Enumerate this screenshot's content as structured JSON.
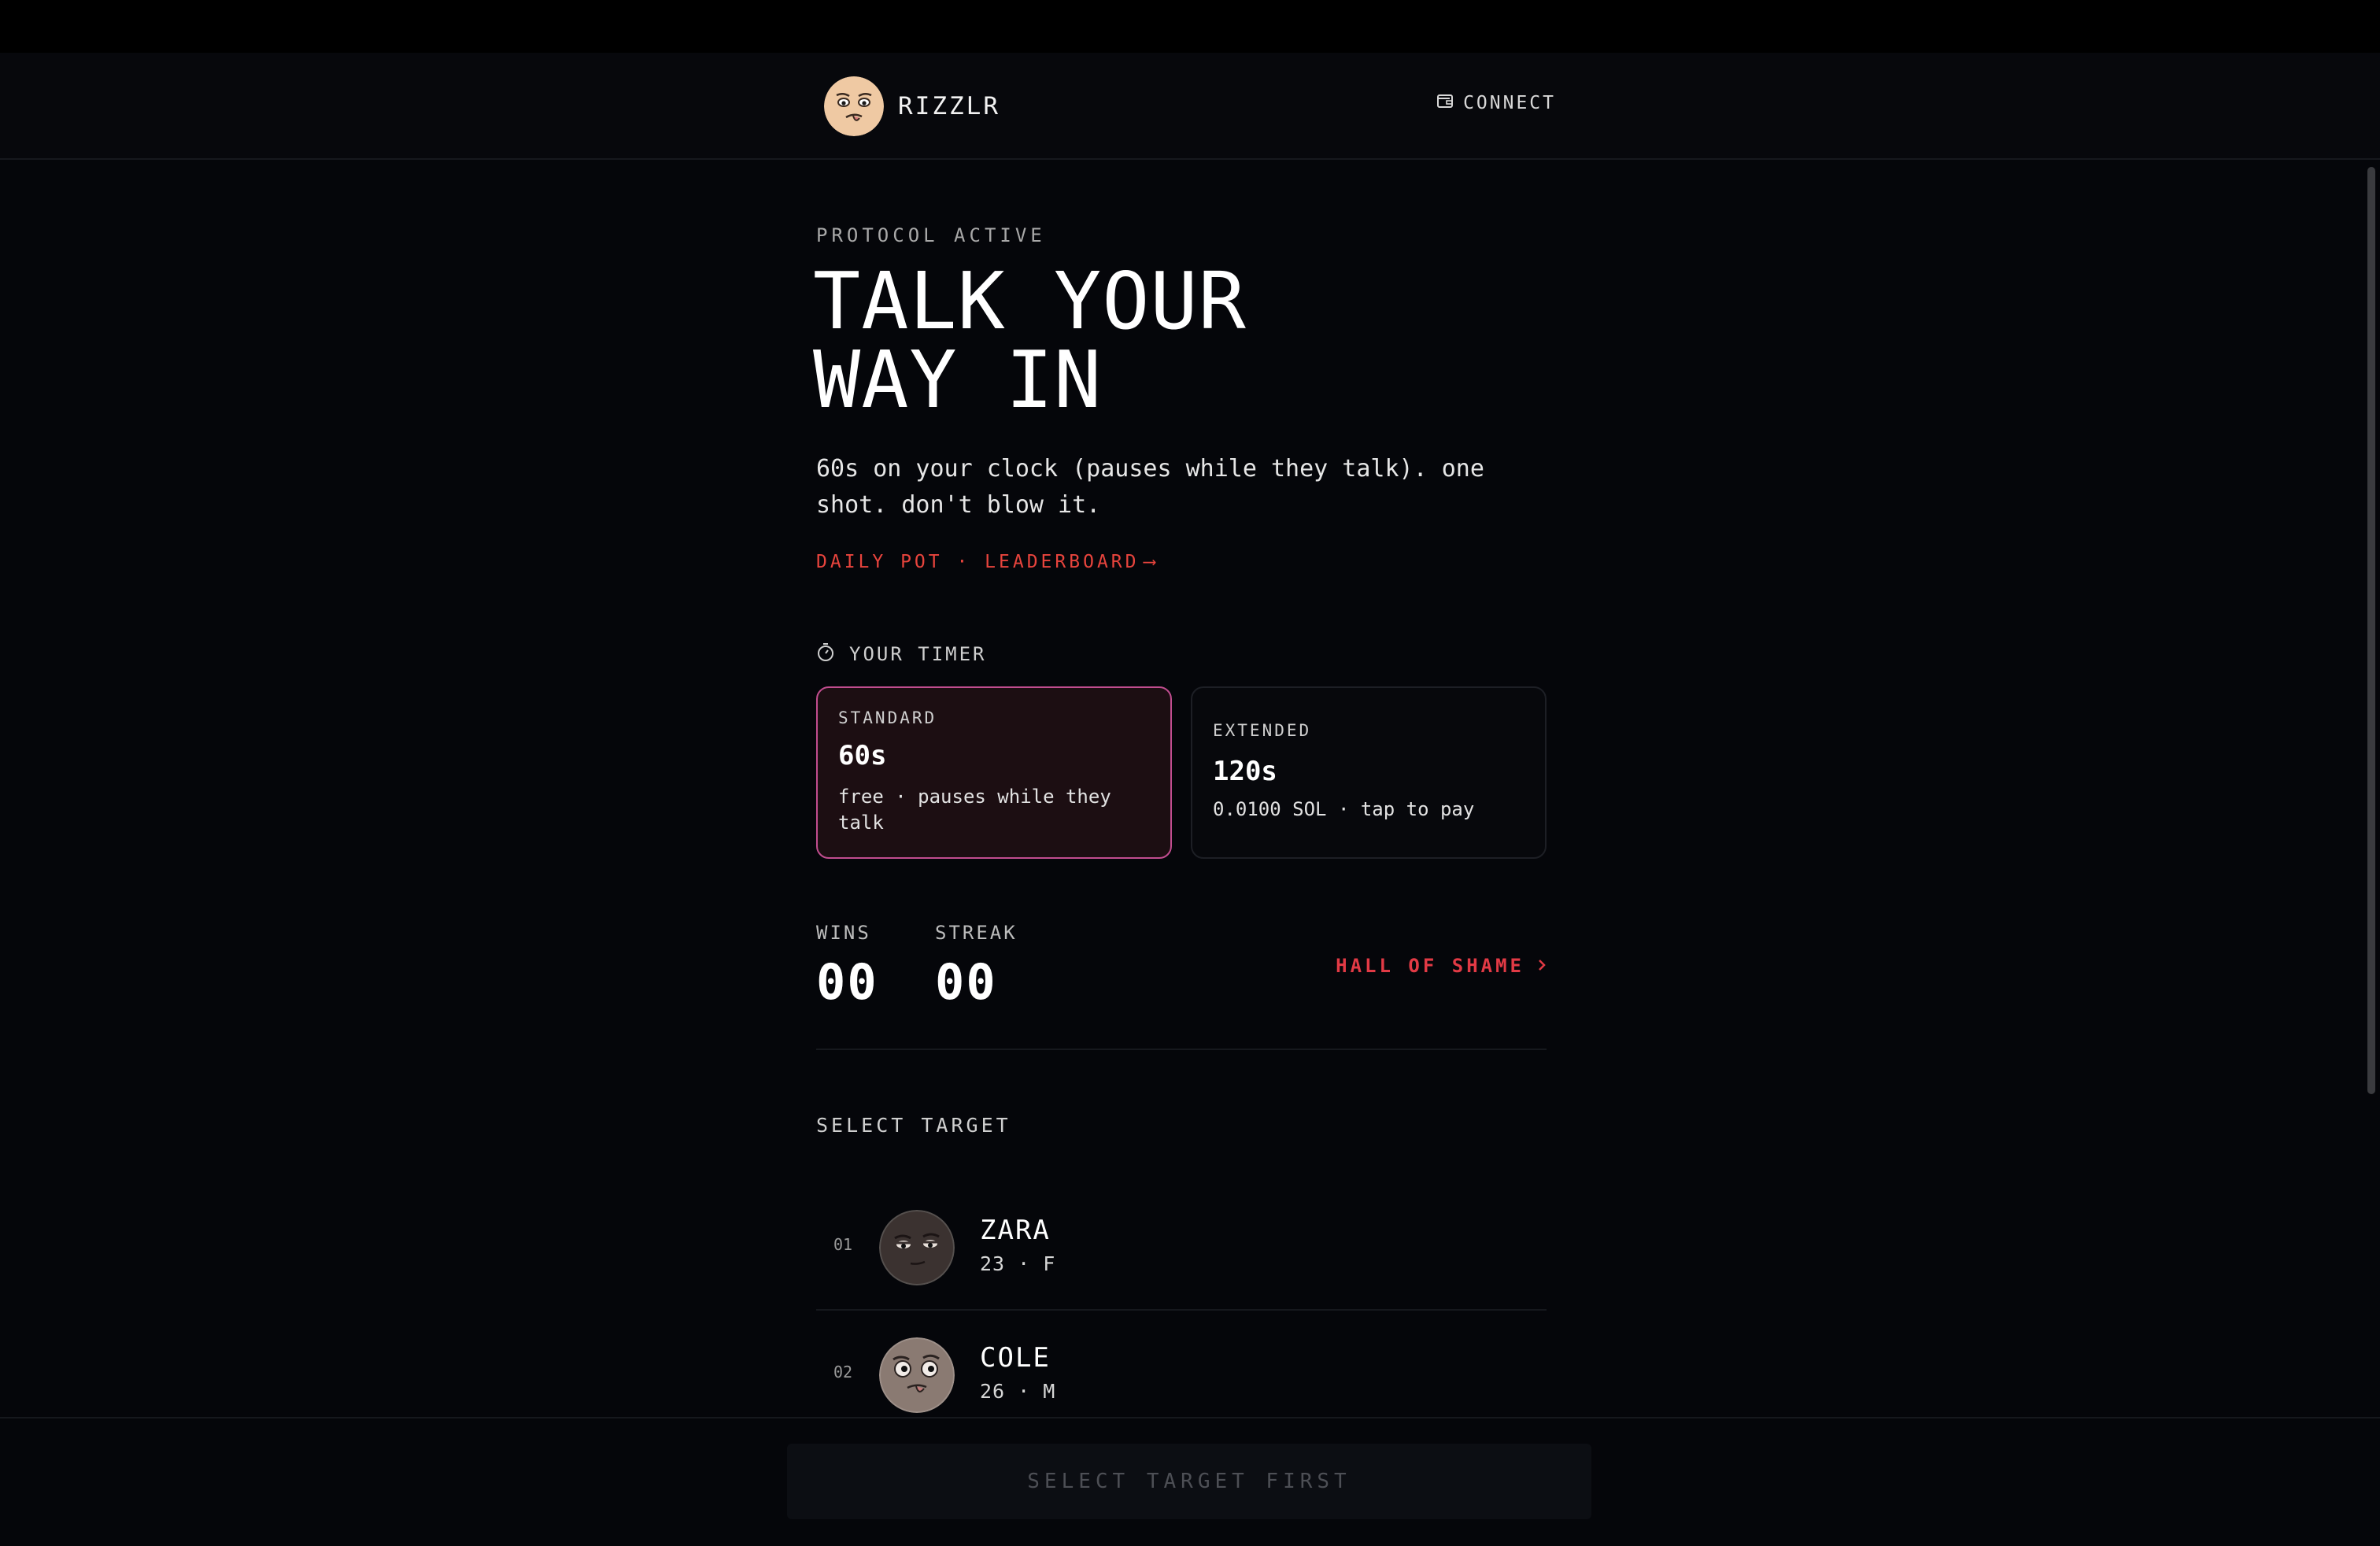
{
  "header": {
    "brand_name": "RIZZLR",
    "connect_label": "CONNECT"
  },
  "hero": {
    "eyebrow": "PROTOCOL ACTIVE",
    "title_line1": "TALK YOUR",
    "title_line2": "WAY IN",
    "subtitle": "60s on your clock (pauses while they talk). one shot. don't blow it.",
    "daily_link": "DAILY POT · LEADERBOARD",
    "daily_arrow": "⟶"
  },
  "timer": {
    "label": "YOUR TIMER",
    "options": [
      {
        "label": "STANDARD",
        "value": "60s",
        "desc": "free · pauses while they talk",
        "selected": true
      },
      {
        "label": "EXTENDED",
        "value": "120s",
        "desc": "0.0100 SOL · tap to pay",
        "selected": false
      }
    ]
  },
  "stats": {
    "wins_label": "WINS",
    "wins_value": "00",
    "streak_label": "STREAK",
    "streak_value": "00",
    "hall_of_shame": "HALL OF SHAME"
  },
  "targets": {
    "label": "SELECT TARGET",
    "items": [
      {
        "num": "01",
        "name": "ZARA",
        "meta": "23 · F",
        "avatar": "zara-avatar"
      },
      {
        "num": "02",
        "name": "COLE",
        "meta": "26 · M",
        "avatar": "cole-avatar"
      }
    ]
  },
  "footer": {
    "cta": "SELECT TARGET FIRST"
  },
  "colors": {
    "accent_red": "#e8443d",
    "selected_border": "#c14d8f",
    "background": "#05060a"
  }
}
